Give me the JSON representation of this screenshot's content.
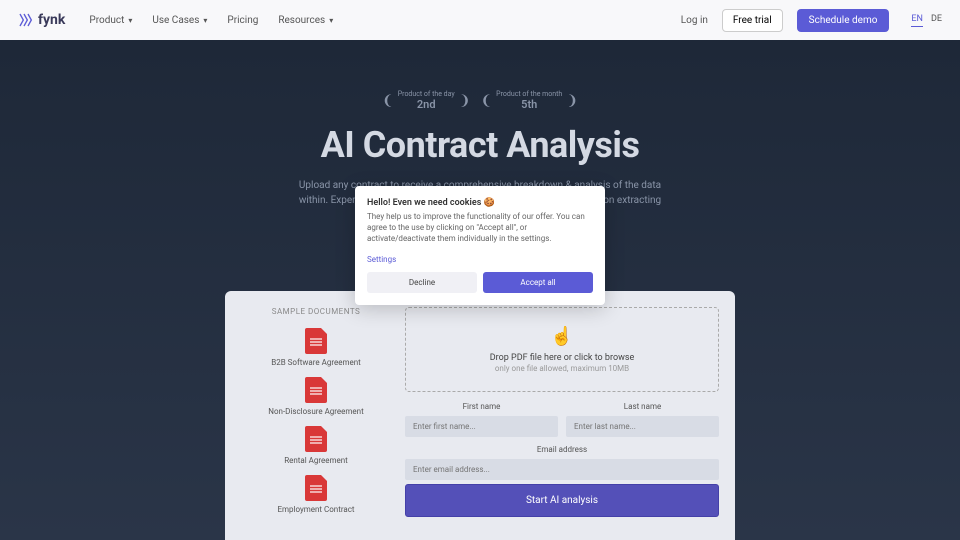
{
  "nav": {
    "brand": "fynk",
    "links": [
      "Product",
      "Use Cases",
      "Pricing",
      "Resources"
    ],
    "login": "Log in",
    "trial": "Free trial",
    "demo": "Schedule demo",
    "lang": [
      "EN",
      "DE"
    ]
  },
  "hero": {
    "badge1_label": "Product of the day",
    "badge1_rank": "2nd",
    "badge2_label": "Product of the month",
    "badge2_rank": "5th",
    "title": "AI Contract Analysis",
    "subtitle": "Upload any contract to receive a comprehensive breakdown & analysis of the data within. Experience first-hand the future of contract review & information extracting powered by semantic AI."
  },
  "samples": {
    "title": "SAMPLE DOCUMENTS",
    "items": [
      "B2B Software Agreement",
      "Non-Disclosure Agreement",
      "Rental Agreement",
      "Employment Contract"
    ]
  },
  "form": {
    "drop_title": "Drop PDF file here or click to browse",
    "drop_sub": "only one file allowed, maximum 10MB",
    "first_label": "First name",
    "first_ph": "Enter first name...",
    "last_label": "Last name",
    "last_ph": "Enter last name...",
    "email_label": "Email address",
    "email_ph": "Enter email address...",
    "submit": "Start AI analysis"
  },
  "cookie": {
    "title": "Hello! Even we need cookies 🍪",
    "text": "They help us to improve the functionality of our offer. You can agree to the use by clicking on \"Accept all\", or activate/deactivate them individually in the settings.",
    "settings": "Settings",
    "decline": "Decline",
    "accept": "Accept all"
  }
}
